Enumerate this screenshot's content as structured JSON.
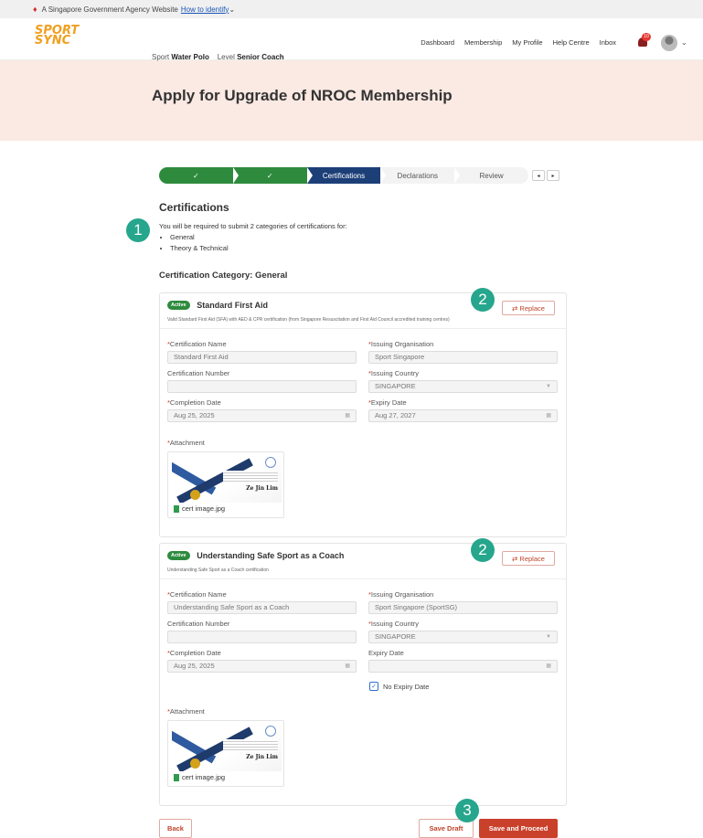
{
  "gov_bar": {
    "text": "A Singapore Government Agency Website",
    "link": "How to identify",
    "caret": "⌄"
  },
  "brand": {
    "line1": "SPORT",
    "line2": "SYNC"
  },
  "nav": {
    "items": [
      "Dashboard",
      "Membership",
      "My Profile",
      "Help Centre",
      "Inbox"
    ],
    "notification_count": "10"
  },
  "page": {
    "title": "Apply for Upgrade of NROC Membership",
    "sport_label": "Sport",
    "sport_value": "Water Polo",
    "level_label": "Level",
    "level_value": "Senior Coach"
  },
  "stepper": {
    "steps": [
      {
        "label": "✓",
        "state": "done"
      },
      {
        "label": "✓",
        "state": "done"
      },
      {
        "label": "Certifications",
        "state": "current"
      },
      {
        "label": "Declarations",
        "state": "todo"
      },
      {
        "label": "Review",
        "state": "todo"
      }
    ],
    "prev": "◂",
    "next": "▸"
  },
  "section": {
    "title": "Certifications",
    "intro": "You will be required to submit 2 categories of certifications for:",
    "bullets": [
      "General",
      "Theory & Technical"
    ],
    "category_title": "Certification Category: General"
  },
  "markers": {
    "m1": "1",
    "m2a": "2",
    "m2b": "2",
    "m3": "3"
  },
  "labels": {
    "status": "Active",
    "replace": "⇄ Replace",
    "cert_name": "Certification Name",
    "issuing_org": "Issuing Organisation",
    "cert_number": "Certification Number",
    "issuing_country": "Issuing Country",
    "completion_date": "Completion Date",
    "expiry_date": "Expiry Date",
    "attachment": "Attachment",
    "no_expiry": "No Expiry Date",
    "req": "*"
  },
  "cards": [
    {
      "title": "Standard First Aid",
      "desc": "Valid Standard First Aid (SFA) with AED & CPR certification (from Singapore Resuscitation and First Aid Council accredited training centres)",
      "cert_name": "Standard First Aid",
      "issuing_org": "Sport Singapore",
      "cert_number": "",
      "issuing_country": "SINGAPORE",
      "completion_date": "Aug 25, 2025",
      "expiry_date": "Aug 27, 2027",
      "attachment_name": "cert image.jpg",
      "cert_holder": "Ze Jin Lim"
    },
    {
      "title": "Understanding Safe Sport as a Coach",
      "desc": "Understanding Safe Sport as a Coach certification",
      "cert_name": "Understanding Safe Sport as a Coach",
      "issuing_org": "Sport Singapore (SportSG)",
      "cert_number": "",
      "issuing_country": "SINGAPORE",
      "completion_date": "Aug 25, 2025",
      "expiry_date": "",
      "no_expiry_checked": true,
      "attachment_name": "cert image.jpg",
      "cert_holder": "Ze Jin Lim"
    }
  ],
  "footer": {
    "back": "Back",
    "save_draft": "Save Draft",
    "save_proceed": "Save and Proceed"
  },
  "colors": {
    "accent": "#c9402b",
    "success": "#2e8b3d",
    "current_step": "#1d3f78",
    "marker": "#26a68c",
    "hero_bg": "#fbe9e3"
  }
}
